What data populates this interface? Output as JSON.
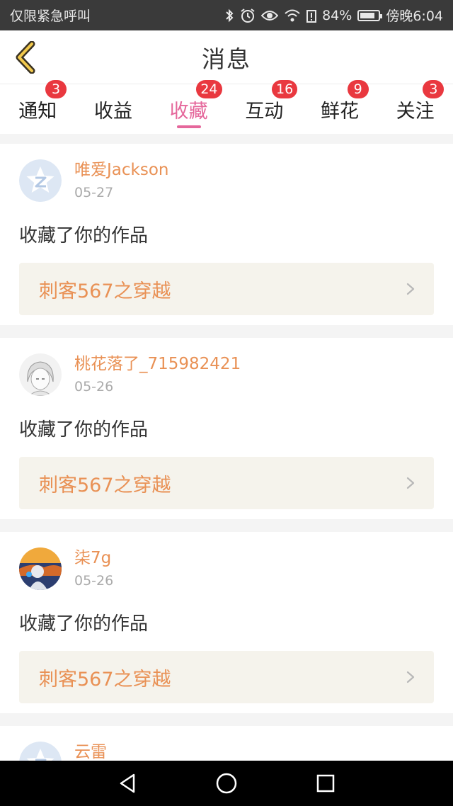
{
  "status_bar": {
    "left_text": "仅限紧急呼叫",
    "battery_percent": "84%",
    "battery_level": 0.84,
    "time": "傍晚6:04",
    "icons": [
      "bluetooth-icon",
      "alarm-icon",
      "eye-icon",
      "wifi-icon",
      "battery-alert-icon",
      "battery-icon"
    ]
  },
  "header": {
    "title": "消息",
    "back_icon": "chevron-left-icon",
    "accent_color": "#f2c94c"
  },
  "tabs": [
    {
      "label": "通知",
      "badge": "3",
      "active": false
    },
    {
      "label": "收益",
      "badge": "",
      "active": false
    },
    {
      "label": "收藏",
      "badge": "24",
      "active": true
    },
    {
      "label": "互动",
      "badge": "16",
      "active": false
    },
    {
      "label": "鲜花",
      "badge": "9",
      "active": false
    },
    {
      "label": "关注",
      "badge": "3",
      "active": false
    }
  ],
  "colors": {
    "active_tab": "#e5679b",
    "badge": "#e9383f",
    "username": "#e99155",
    "work_bg": "#f5f3ec"
  },
  "feed": [
    {
      "username": "唯爱Jackson",
      "date": "05-27",
      "action": "收藏了你的作品",
      "work": "刺客567之穿越",
      "avatar": "default-avatar-icon"
    },
    {
      "username": "桃花落了_715982421",
      "date": "05-26",
      "action": "收藏了你的作品",
      "work": "刺客567之穿越",
      "avatar": "anime-avatar"
    },
    {
      "username": "柒7g",
      "date": "05-26",
      "action": "收藏了你的作品",
      "work": "刺客567之穿越",
      "avatar": "photo-avatar"
    },
    {
      "username": "云雷",
      "date": "",
      "action": "",
      "work": "",
      "avatar": "default-avatar-icon"
    }
  ],
  "nav_bar": {
    "buttons": [
      "back-triangle-icon",
      "home-circle-icon",
      "recents-square-icon"
    ]
  }
}
